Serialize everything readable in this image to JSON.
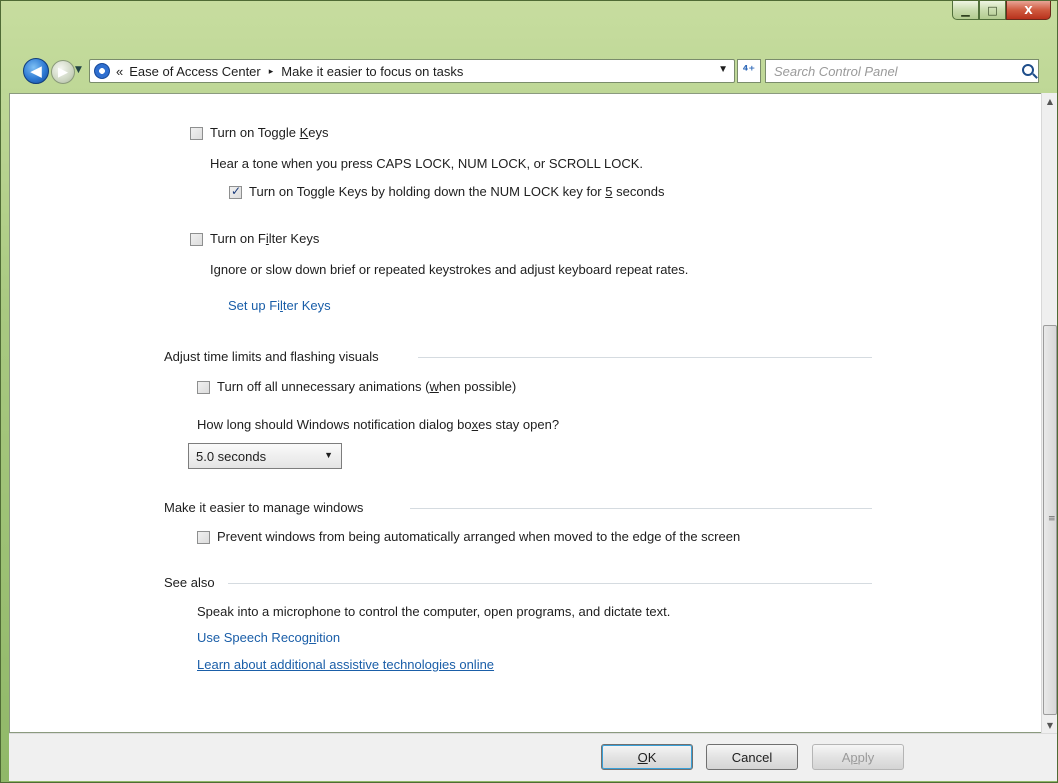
{
  "window": {
    "caption": {
      "minimize": "▁",
      "maximize": "□",
      "close": "X"
    }
  },
  "navigation": {
    "back_icon": "back-arrow-icon",
    "forward_icon": "forward-arrow-icon",
    "breadcrumb_prefix": "«",
    "breadcrumb": [
      "Ease of Access Center",
      "Make it easier to focus on tasks"
    ],
    "breadcrumb_separator": "▸",
    "refresh_symbol": "⁴⁺",
    "search_placeholder": "Search Control Panel"
  },
  "toggle_keys": {
    "checkbox_pre": "Turn on Toggle ",
    "checkbox_u": "K",
    "checkbox_post": "eys",
    "checked": false,
    "description": "Hear a tone when you press CAPS LOCK, NUM LOCK, or SCROLL LOCK.",
    "sub_checkbox_pre": "Turn on Toggle Keys by holding down the NUM LOCK key for ",
    "sub_checkbox_u": "5",
    "sub_checkbox_post": " seconds",
    "sub_checked": true
  },
  "filter_keys": {
    "checkbox_pre": "Turn on F",
    "checkbox_u": "i",
    "checkbox_post": "lter Keys",
    "checked": false,
    "description": "Ignore or slow down brief or repeated keystrokes and adjust keyboard repeat rates.",
    "link_pre": "Set up Fi",
    "link_u": "l",
    "link_post": "ter Keys"
  },
  "time_limits": {
    "title": "Adjust time limits and flashing visuals",
    "animations_pre": "Turn off all unnecessary animations (",
    "animations_u": "w",
    "animations_post": "hen possible)",
    "animations_checked": false,
    "question_pre": "How long should Windows notification dialog bo",
    "question_u": "x",
    "question_post": "es stay open?",
    "selected_duration": "5.0 seconds"
  },
  "manage_windows": {
    "title": "Make it easier to manage windows",
    "prevent_arrange": "Prevent windows from being automatically arranged when moved to the edge of the screen",
    "prevent_checked": false
  },
  "see_also": {
    "title": "See also",
    "speech_description": "Speak into a microphone to control the computer, open programs, and dictate text.",
    "speech_link_pre": "Use Speech Recog",
    "speech_link_u": "n",
    "speech_link_post": "ition",
    "assistive_link": "Learn about additional assistive technologies online"
  },
  "buttons": {
    "ok_u": "O",
    "ok_post": "K",
    "cancel": "Cancel",
    "apply_pre": "A",
    "apply_u": "p",
    "apply_post": "ply"
  },
  "colors": {
    "link": "#1a5ea8",
    "frame": "#a9c981",
    "close_button": "#cf5a3f"
  }
}
